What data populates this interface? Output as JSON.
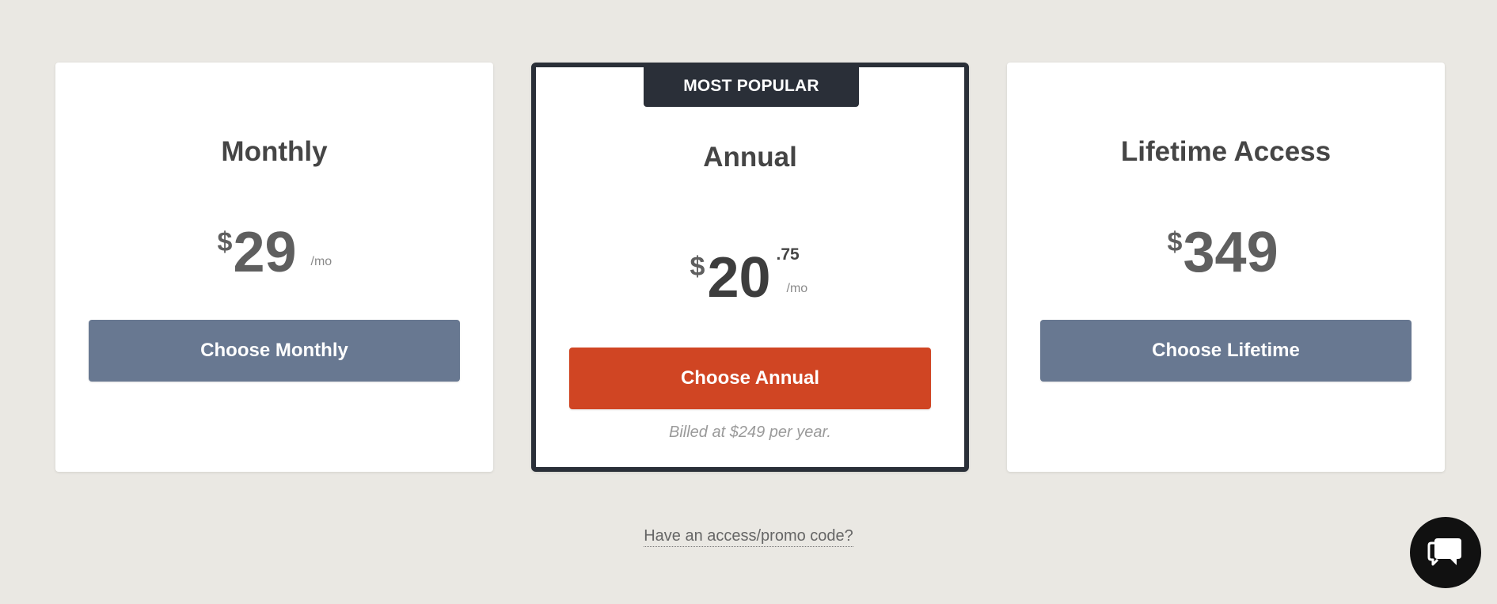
{
  "plans": {
    "monthly": {
      "title": "Monthly",
      "currency": "$",
      "amount": "29",
      "per": "/mo",
      "button_label": "Choose Monthly"
    },
    "annual": {
      "badge": "MOST POPULAR",
      "title": "Annual",
      "currency": "$",
      "amount": "20",
      "cents": ".75",
      "per": "/mo",
      "button_label": "Choose Annual",
      "billing_note": "Billed at $249 per year."
    },
    "lifetime": {
      "title": "Lifetime Access",
      "currency": "$",
      "amount": "349",
      "button_label": "Choose Lifetime"
    }
  },
  "promo": {
    "label": "Have an access/promo code?"
  },
  "icons": {
    "chat": "chat-icon"
  },
  "colors": {
    "background": "#eae8e3",
    "card": "#ffffff",
    "highlight_border": "#2a2f38",
    "secondary_button": "#687891",
    "primary_button": "#d04523",
    "chat_bubble": "#111111"
  }
}
